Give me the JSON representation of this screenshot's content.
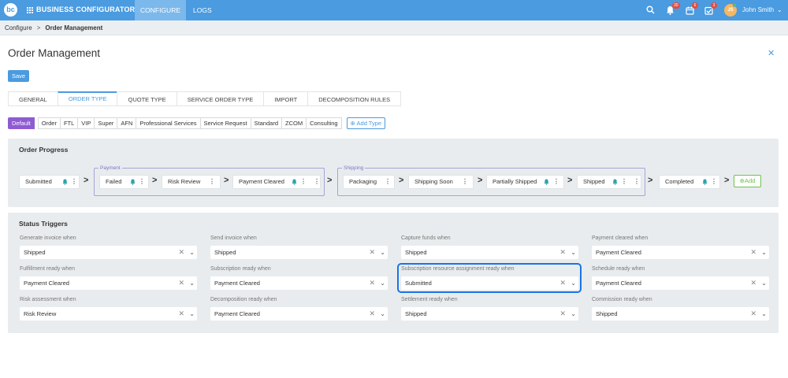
{
  "topbar": {
    "brand": "BUSINESS CONFIGURATOR",
    "tabs": [
      {
        "label": "CONFIGURE",
        "active": true
      },
      {
        "label": "LOGS",
        "active": false
      }
    ],
    "icons": [
      "search-icon",
      "bell-icon",
      "calendar-icon",
      "tasks-icon"
    ],
    "badges": {
      "notifications": "30",
      "calendar": "6",
      "tasks": "3"
    },
    "user": {
      "initials": "JS",
      "name": "John Smith"
    }
  },
  "breadcrumb": {
    "root": "Configure",
    "current": "Order Management"
  },
  "page": {
    "title": "Order Management",
    "save_label": "Save"
  },
  "tabs": [
    "GENERAL",
    "ORDER TYPE",
    "QUOTE TYPE",
    "SERVICE ORDER TYPE",
    "IMPORT",
    "DECOMPOSITION RULES"
  ],
  "active_tab": "ORDER TYPE",
  "types": [
    "Default",
    "Order",
    "FTL",
    "VIP",
    "Super",
    "AFN",
    "Professional Services",
    "Service Request",
    "Standard",
    "ZCOM",
    "Consulting"
  ],
  "add_type_label": "Add Type",
  "order_progress": {
    "title": "Order Progress",
    "groups": {
      "payment": "Payment",
      "shipping": "Shipping"
    },
    "stages": [
      "Submitted",
      "Failed",
      "Risk Review",
      "Payment Cleared",
      "Packaging",
      "Shipping Soon",
      "Partially Shipped",
      "Shipped",
      "Completed"
    ],
    "add_label": "Add"
  },
  "status_triggers": {
    "title": "Status Triggers",
    "fields": [
      {
        "label": "Generate invoice when",
        "value": "Shipped"
      },
      {
        "label": "Send invoice when",
        "value": "Shipped"
      },
      {
        "label": "Capture funds when",
        "value": "Shipped"
      },
      {
        "label": "Payment cleared when",
        "value": "Payment Cleared"
      },
      {
        "label": "Fulfillment ready when",
        "value": "Payment Cleared"
      },
      {
        "label": "Subscription ready when",
        "value": "Payment Cleared"
      },
      {
        "label": "Subscription resource assignment ready when",
        "value": "Submitted"
      },
      {
        "label": "Schedule ready when",
        "value": "Payment Cleared"
      },
      {
        "label": "Risk assessment when",
        "value": "Risk Review"
      },
      {
        "label": "Decomposition ready when",
        "value": "Payment Cleared"
      },
      {
        "label": "Settlement ready when",
        "value": "Shipped"
      },
      {
        "label": "Commission ready when",
        "value": "Shipped"
      }
    ]
  },
  "colors": {
    "accent": "#4a9be0",
    "default_type": "#8e5bd3",
    "group_border": "#a8a2d8",
    "add_green": "#6cc24a",
    "focus": "#1a73e8"
  }
}
